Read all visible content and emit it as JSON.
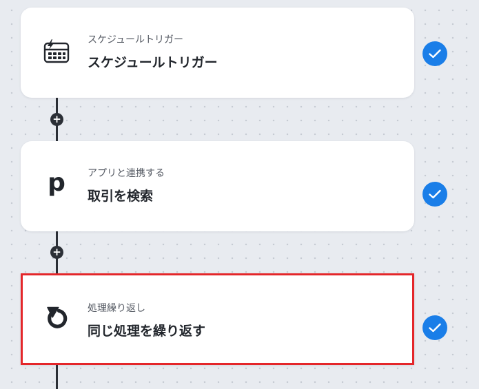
{
  "steps": [
    {
      "subtitle": "スケジュールトリガー",
      "title": "スケジュールトリガー",
      "icon": "calendar-trigger-icon",
      "status": "completed",
      "selected": false
    },
    {
      "subtitle": "アプリと連携する",
      "title": "取引を検索",
      "icon": "p-letter-icon",
      "icon_text": "p",
      "status": "completed",
      "selected": false
    },
    {
      "subtitle": "処理繰り返し",
      "title": "同じ処理を繰り返す",
      "icon": "loop-arrow-icon",
      "status": "completed",
      "selected": true
    }
  ],
  "add_step_symbol": "+",
  "check_icon": "checkmark-icon",
  "colors": {
    "canvas_background": "#e8ebf0",
    "canvas_dots": "#c6cbd3",
    "connector": "#2b2f36",
    "check_blue": "#1a7ee8",
    "selection_red": "#e4262a"
  }
}
